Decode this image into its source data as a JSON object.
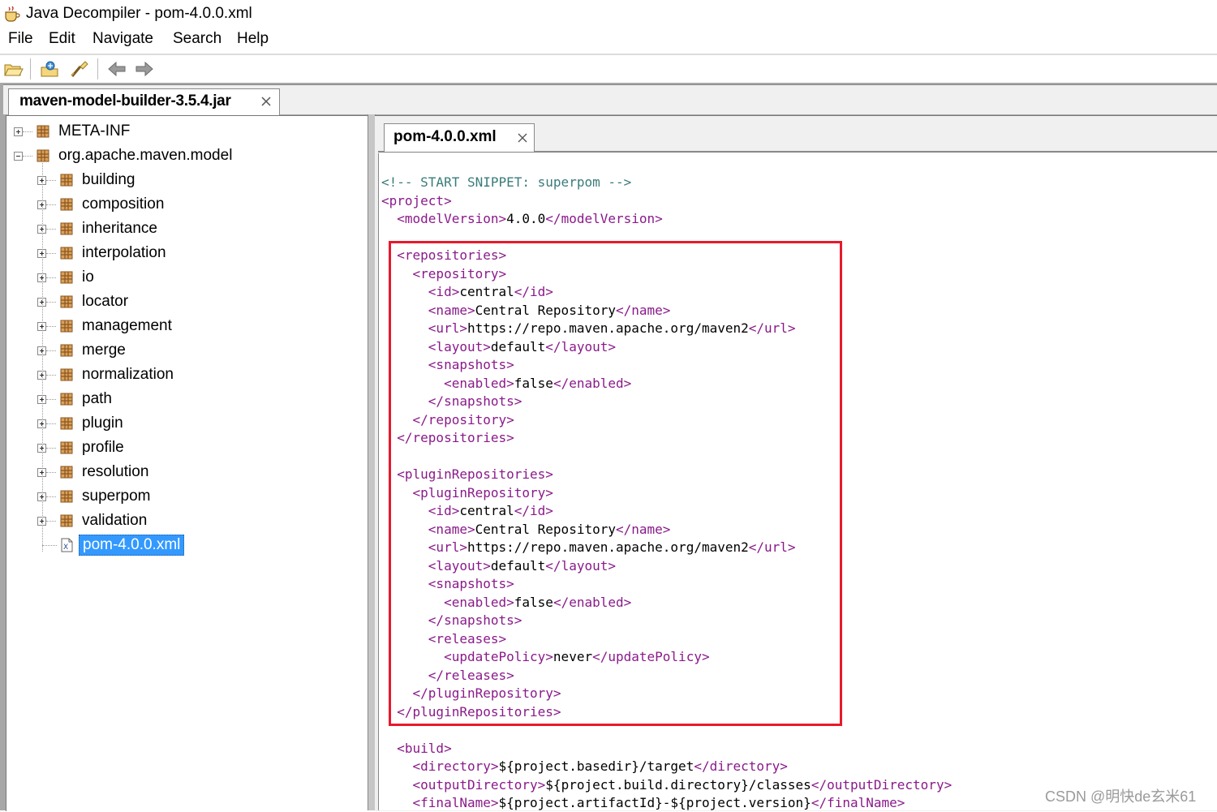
{
  "window": {
    "title": "Java Decompiler - pom-4.0.0.xml"
  },
  "menu": [
    "File",
    "Edit",
    "Navigate",
    "Search",
    "Help"
  ],
  "toolbar": {
    "buttons": [
      "open-file-icon",
      "open-type-icon",
      "search-icon",
      "back-arrow-icon",
      "forward-arrow-icon"
    ]
  },
  "jar_tab": {
    "label": "maven-model-builder-3.5.4.jar"
  },
  "tree": {
    "items": [
      {
        "label": "META-INF",
        "expanded": false,
        "icon": "package-icon"
      },
      {
        "label": "org.apache.maven.model",
        "expanded": true,
        "icon": "package-icon"
      },
      {
        "label": "building",
        "icon": "package-icon"
      },
      {
        "label": "composition",
        "icon": "package-icon"
      },
      {
        "label": "inheritance",
        "icon": "package-icon"
      },
      {
        "label": "interpolation",
        "icon": "package-icon"
      },
      {
        "label": "io",
        "icon": "package-icon"
      },
      {
        "label": "locator",
        "icon": "package-icon"
      },
      {
        "label": "management",
        "icon": "package-icon"
      },
      {
        "label": "merge",
        "icon": "package-icon"
      },
      {
        "label": "normalization",
        "icon": "package-icon"
      },
      {
        "label": "path",
        "icon": "package-icon"
      },
      {
        "label": "plugin",
        "icon": "package-icon"
      },
      {
        "label": "profile",
        "icon": "package-icon"
      },
      {
        "label": "resolution",
        "icon": "package-icon"
      },
      {
        "label": "superpom",
        "icon": "package-icon"
      },
      {
        "label": "validation",
        "icon": "package-icon"
      },
      {
        "label": "pom-4.0.0.xml",
        "icon": "xml-file-icon",
        "selected": true
      }
    ]
  },
  "file_tab": {
    "label": "pom-4.0.0.xml"
  },
  "code": {
    "lines": [
      "<!-- START SNIPPET: superpom -->",
      "<project>",
      "  <modelVersion>4.0.0</modelVersion>",
      "",
      "  <repositories>",
      "    <repository>",
      "      <id>central</id>",
      "      <name>Central Repository</name>",
      "      <url>https://repo.maven.apache.org/maven2</url>",
      "      <layout>default</layout>",
      "      <snapshots>",
      "        <enabled>false</enabled>",
      "      </snapshots>",
      "    </repository>",
      "  </repositories>",
      "",
      "  <pluginRepositories>",
      "    <pluginRepository>",
      "      <id>central</id>",
      "      <name>Central Repository</name>",
      "      <url>https://repo.maven.apache.org/maven2</url>",
      "      <layout>default</layout>",
      "      <snapshots>",
      "        <enabled>false</enabled>",
      "      </snapshots>",
      "      <releases>",
      "        <updatePolicy>never</updatePolicy>",
      "      </releases>",
      "    </pluginRepository>",
      "  </pluginRepositories>",
      "",
      "  <build>",
      "    <directory>${project.basedir}/target</directory>",
      "    <outputDirectory>${project.build.directory}/classes</outputDirectory>",
      "    <finalName>${project.artifactId}-${project.version}</finalName>"
    ]
  },
  "colors": {
    "highlight_border": "#e8192c",
    "selection": "#3399ff",
    "xml_tag": "#8a1a8a",
    "comment": "#3a7b7b"
  },
  "watermark": "CSDN @明快de玄米61"
}
